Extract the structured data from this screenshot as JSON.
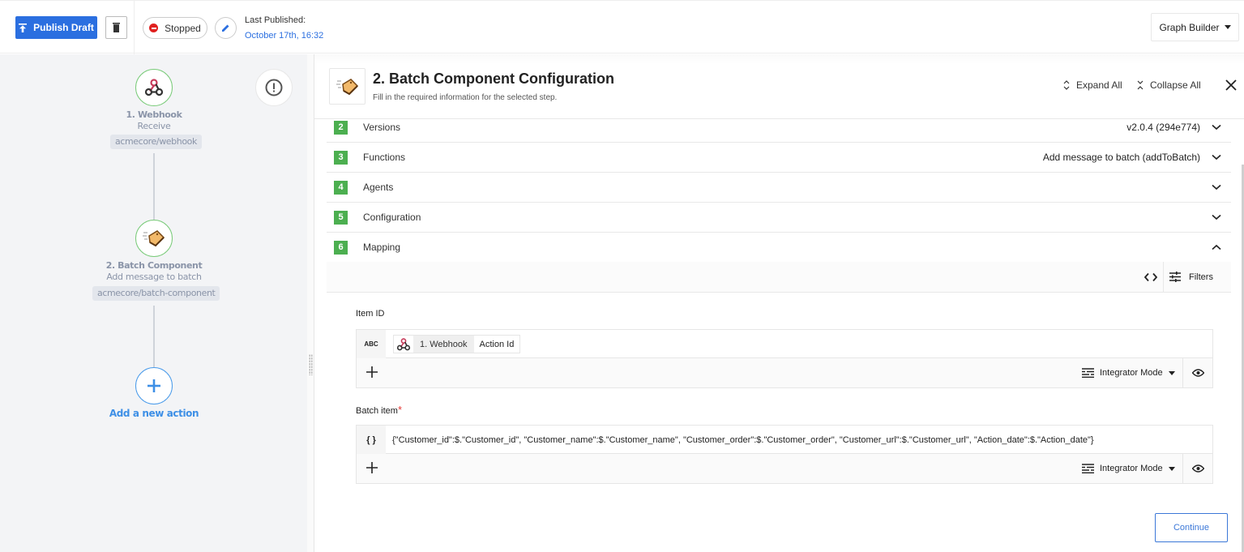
{
  "topbar": {
    "publish_label": "Publish Draft",
    "status_label": "Stopped",
    "last_published_label": "Last Published:",
    "last_published_date": "October 17th, 16:32",
    "view_mode": "Graph Builder"
  },
  "canvas": {
    "nodes": [
      {
        "title": "1. Webhook",
        "subtitle": "Receive",
        "tag": "acmecore/webhook"
      },
      {
        "title": "2. Batch Component",
        "subtitle": "Add message to batch",
        "tag": "acmecore/batch-component"
      }
    ],
    "add_action_label": "Add a new action"
  },
  "panel": {
    "title": "2. Batch Component Configuration",
    "subtitle": "Fill in the required information for the selected step.",
    "expand_all": "Expand All",
    "collapse_all": "Collapse All",
    "sections": [
      {
        "num": "2",
        "label": "Versions",
        "value": "v2.0.4 (294e774)",
        "expanded": false
      },
      {
        "num": "3",
        "label": "Functions",
        "value": "Add message to batch (addToBatch)",
        "expanded": false
      },
      {
        "num": "4",
        "label": "Agents",
        "value": "",
        "expanded": false
      },
      {
        "num": "5",
        "label": "Configuration",
        "value": "",
        "expanded": false
      },
      {
        "num": "6",
        "label": "Mapping",
        "value": "",
        "expanded": true
      }
    ],
    "mapping": {
      "filters_label": "Filters",
      "fields": [
        {
          "label": "Item ID",
          "required": false,
          "type_badge": "ABC",
          "pill_source": "1. Webhook",
          "pill_field": "Action Id",
          "mode": "Integrator Mode"
        },
        {
          "label": "Batch item",
          "required": true,
          "required_mark": "*",
          "type_badge": "{ }",
          "value": "{\"Customer_id\":$.\"Customer_id\", \"Customer_name\":$.\"Customer_name\", \"Customer_order\":$.\"Customer_order\", \"Customer_url\":$.\"Customer_url\", \"Action_date\":$.\"Action_date\"}",
          "mode": "Integrator Mode"
        }
      ]
    },
    "continue_label": "Continue"
  },
  "colors": {
    "primary": "#2b6fe0",
    "success": "#4caf50",
    "danger": "#e0201f",
    "node_text": "#8a94a8",
    "add_action": "#3d8fe6"
  }
}
